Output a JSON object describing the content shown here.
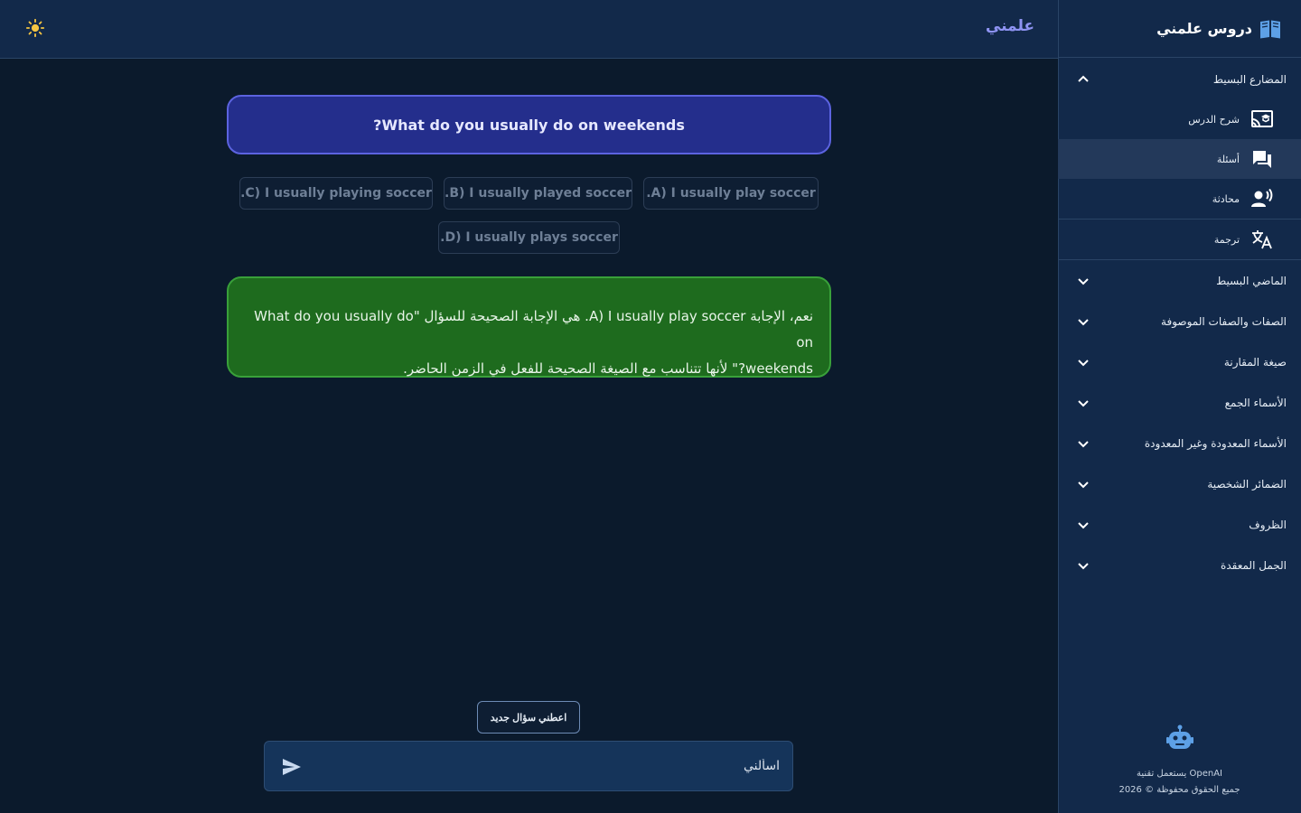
{
  "sidebar": {
    "title": "دروس علمني",
    "sections": [
      {
        "label": "المضارع البسيط",
        "expanded": true
      },
      {
        "label": "الماضي البسيط",
        "expanded": false
      },
      {
        "label": "الصفات والصفات الموصوفة",
        "expanded": false
      },
      {
        "label": "صيغة المقارنة",
        "expanded": false
      },
      {
        "label": "الأسماء الجمع",
        "expanded": false
      },
      {
        "label": "الأسماء المعدودة وغير المعدودة",
        "expanded": false
      },
      {
        "label": "الضمائر الشخصية",
        "expanded": false
      },
      {
        "label": "الظروف",
        "expanded": false
      },
      {
        "label": "الجمل المعقدة",
        "expanded": false
      }
    ],
    "subitems": [
      {
        "label": "شرح الدرس",
        "icon": "cast-for-education-icon",
        "active": false
      },
      {
        "label": "أسئلة",
        "icon": "forum-icon",
        "active": true
      },
      {
        "label": "محادثة",
        "icon": "record-voice-icon",
        "active": false
      },
      {
        "label": "ترجمة",
        "icon": "translate-icon",
        "active": false
      }
    ],
    "footer": {
      "powered": "يستعمل تقنية OpenAI",
      "copyright": "جميع الحقوق محفوظة © 2026"
    }
  },
  "topbar": {
    "brand": "علمني",
    "theme_icon": "sun-icon"
  },
  "main": {
    "question": "?What do you usually do on weekends",
    "options": [
      ".A) I usually play soccer",
      ".B) I usually played soccer",
      ".C) I usually playing soccer",
      ".D) I usually plays soccer"
    ],
    "answer": {
      "line1": "نعم، الإجابة A) I usually play soccer. هي الإجابة الصحيحة للسؤال \"What do you usually do on",
      "line2": "weekends?\" لأنها تتناسب مع الصيغة الصحيحة للفعل في الزمن الحاضر."
    },
    "new_question_label": "اعطني سؤال جديد",
    "chat_placeholder": "اسألني"
  },
  "colors": {
    "background": "#0b1a2c",
    "panel": "#12294a",
    "question_bg": "#242e8c",
    "answer_bg": "#1e6b1e",
    "brand": "#8e93f2"
  }
}
